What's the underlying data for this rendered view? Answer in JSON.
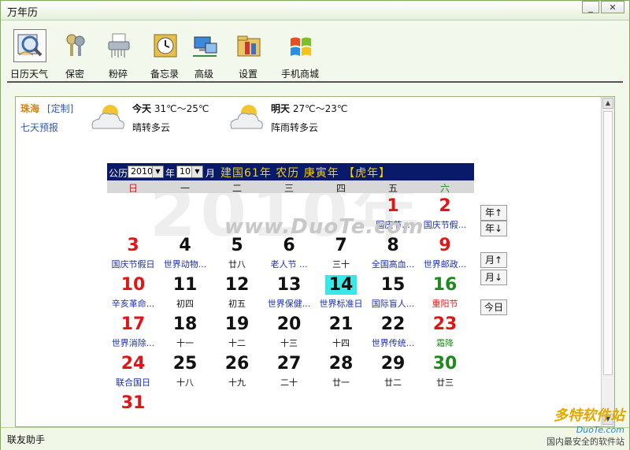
{
  "window": {
    "title": "万年历"
  },
  "toolbar": {
    "items": [
      {
        "label": "日历天气",
        "icon": "calendar-weather-icon"
      },
      {
        "label": "保密",
        "icon": "keys-icon"
      },
      {
        "label": "粉碎",
        "icon": "shredder-icon"
      },
      {
        "label": "备忘录",
        "icon": "alarm-clock-icon"
      },
      {
        "label": "高级",
        "icon": "network-computer-icon"
      },
      {
        "label": "设置",
        "icon": "settings-folder-icon"
      },
      {
        "label": "手机商城",
        "icon": "windows-logo-icon"
      }
    ]
  },
  "weather": {
    "city": "珠海",
    "custom_link": "[定制]",
    "seven_day_link": "七天预报",
    "today": {
      "label": "今天",
      "temp": "31℃～25℃",
      "desc": "晴转多云"
    },
    "tomorrow": {
      "label": "明天",
      "temp": "27℃～23℃",
      "desc": "阵雨转多云"
    }
  },
  "calendar": {
    "gongli_label": "公历",
    "year": "2010",
    "year_unit": "年",
    "month": "10",
    "month_unit": "月",
    "ganzhi": "建国61年  农历  庚寅年  【虎年】",
    "weekdays": [
      "日",
      "一",
      "二",
      "三",
      "四",
      "五",
      "六"
    ],
    "rows": [
      [
        null,
        null,
        null,
        null,
        null,
        {
          "day": "1",
          "sub": "国庆节...",
          "numColor": "red",
          "subColor": "blue"
        },
        {
          "day": "2",
          "sub": "国庆节假...",
          "numColor": "red",
          "subColor": "blue"
        }
      ],
      [
        {
          "day": "3",
          "sub": "国庆节假日",
          "numColor": "red",
          "subColor": "blue"
        },
        {
          "day": "4",
          "sub": "世界动物...",
          "numColor": "",
          "subColor": "blue"
        },
        {
          "day": "5",
          "sub": "廿八",
          "numColor": "",
          "subColor": ""
        },
        {
          "day": "6",
          "sub": "老人节 ...",
          "numColor": "",
          "subColor": "blue"
        },
        {
          "day": "7",
          "sub": "三十",
          "numColor": "",
          "subColor": ""
        },
        {
          "day": "8",
          "sub": "全国高血...",
          "numColor": "",
          "subColor": "blue"
        },
        {
          "day": "9",
          "sub": "世界邮政...",
          "numColor": "red",
          "subColor": "blue"
        }
      ],
      [
        {
          "day": "10",
          "sub": "辛亥革命...",
          "numColor": "red",
          "subColor": "blue"
        },
        {
          "day": "11",
          "sub": "初四",
          "numColor": "",
          "subColor": ""
        },
        {
          "day": "12",
          "sub": "初五",
          "numColor": "",
          "subColor": ""
        },
        {
          "day": "13",
          "sub": "世界保健...",
          "numColor": "",
          "subColor": "blue"
        },
        {
          "day": "14",
          "sub": "世界标准日",
          "numColor": "",
          "subColor": "blue",
          "today": true
        },
        {
          "day": "15",
          "sub": "国际盲人...",
          "numColor": "",
          "subColor": "blue"
        },
        {
          "day": "16",
          "sub": "重阳节",
          "numColor": "green",
          "subColor": "red"
        }
      ],
      [
        {
          "day": "17",
          "sub": "世界消除...",
          "numColor": "red",
          "subColor": "blue"
        },
        {
          "day": "18",
          "sub": "十一",
          "numColor": "",
          "subColor": ""
        },
        {
          "day": "19",
          "sub": "十二",
          "numColor": "",
          "subColor": ""
        },
        {
          "day": "20",
          "sub": "十三",
          "numColor": "",
          "subColor": ""
        },
        {
          "day": "21",
          "sub": "十四",
          "numColor": "",
          "subColor": ""
        },
        {
          "day": "22",
          "sub": "世界传统...",
          "numColor": "",
          "subColor": "blue"
        },
        {
          "day": "23",
          "sub": "霜降",
          "numColor": "red",
          "subColor": "green"
        }
      ],
      [
        {
          "day": "24",
          "sub": "联合国日",
          "numColor": "red",
          "subColor": "blue"
        },
        {
          "day": "25",
          "sub": "十八",
          "numColor": "",
          "subColor": ""
        },
        {
          "day": "26",
          "sub": "十九",
          "numColor": "",
          "subColor": ""
        },
        {
          "day": "27",
          "sub": "二十",
          "numColor": "",
          "subColor": ""
        },
        {
          "day": "28",
          "sub": "廿一",
          "numColor": "",
          "subColor": ""
        },
        {
          "day": "29",
          "sub": "廿二",
          "numColor": "",
          "subColor": ""
        },
        {
          "day": "30",
          "sub": "廿三",
          "numColor": "green",
          "subColor": ""
        }
      ],
      [
        {
          "day": "31",
          "sub": "",
          "numColor": "red",
          "subColor": ""
        },
        null,
        null,
        null,
        null,
        null,
        null
      ]
    ],
    "watermark_text": "2010年",
    "site_watermark": "www.DuoTe.com"
  },
  "nav": {
    "year_up": "年↑",
    "year_down": "年↓",
    "month_up": "月↑",
    "month_down": "月↓",
    "today": "今日"
  },
  "status": {
    "text": "联友助手"
  },
  "brand": {
    "name": "多特软件站",
    "url": "DuoTe.com",
    "slogan": "国内最安全的软件站"
  },
  "colors": {
    "header_bg": "#0a1a6b",
    "accent_yellow": "#f5d000",
    "today_bg": "#37e8e8",
    "holiday_red": "#e01616",
    "solar_term_green": "#1e8a1e"
  }
}
